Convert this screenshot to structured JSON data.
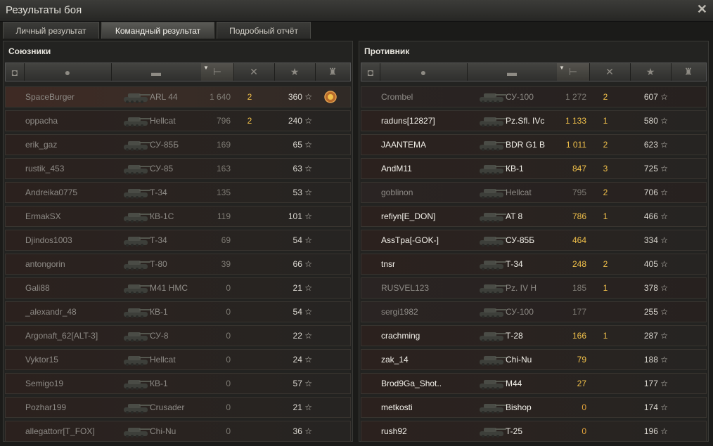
{
  "window": {
    "title": "Результаты боя",
    "close_icon": "close-icon"
  },
  "tabs": [
    {
      "label": "Личный результат",
      "active": false
    },
    {
      "label": "Командный результат",
      "active": true
    },
    {
      "label": "Подробный отчёт",
      "active": false
    }
  ],
  "allies": {
    "title": "Союзники",
    "rows": [
      {
        "name": "SpaceBurger",
        "tank": "ARL 44",
        "damage": "1 640",
        "kills": "2",
        "xp": "360",
        "medal": true,
        "highlight": true
      },
      {
        "name": "oppacha",
        "tank": "Hellcat",
        "damage": "796",
        "kills": "2",
        "xp": "240"
      },
      {
        "name": "erik_gaz",
        "tank": "СУ-85Б",
        "damage": "169",
        "kills": "",
        "xp": "65"
      },
      {
        "name": "rustik_453",
        "tank": "СУ-85",
        "damage": "163",
        "kills": "",
        "xp": "63"
      },
      {
        "name": "Andreika0775",
        "tank": "Т-34",
        "damage": "135",
        "kills": "",
        "xp": "53"
      },
      {
        "name": "ErmakSX",
        "tank": "КВ-1С",
        "damage": "119",
        "kills": "",
        "xp": "101"
      },
      {
        "name": "Djindos1003",
        "tank": "Т-34",
        "damage": "69",
        "kills": "",
        "xp": "54"
      },
      {
        "name": "antongorin",
        "tank": "Т-80",
        "damage": "39",
        "kills": "",
        "xp": "66"
      },
      {
        "name": "Gali88",
        "tank": "M41 HMC",
        "damage": "0",
        "kills": "",
        "xp": "21"
      },
      {
        "name": "_alexandr_48",
        "tank": "КВ-1",
        "damage": "0",
        "kills": "",
        "xp": "54"
      },
      {
        "name": "Argonaft_62[ALT-3]",
        "tank": "СУ-8",
        "damage": "0",
        "kills": "",
        "xp": "22"
      },
      {
        "name": "Vyktor15",
        "tank": "Hellcat",
        "damage": "0",
        "kills": "",
        "xp": "24"
      },
      {
        "name": "Semigo19",
        "tank": "КВ-1",
        "damage": "0",
        "kills": "",
        "xp": "57"
      },
      {
        "name": "Pozhar199",
        "tank": "Crusader",
        "damage": "0",
        "kills": "",
        "xp": "21"
      },
      {
        "name": "allegattorr[T_FOX]",
        "tank": "Chi-Nu",
        "damage": "0",
        "kills": "",
        "xp": "36"
      }
    ]
  },
  "enemies": {
    "title": "Противник",
    "rows": [
      {
        "name": "Crombel",
        "tank": "СУ-100",
        "damage": "1 272",
        "kills": "2",
        "xp": "607",
        "alive": false
      },
      {
        "name": "raduns[12827]",
        "tank": "Pz.Sfl. IVc",
        "damage": "1 133",
        "kills": "1",
        "xp": "580",
        "alive": true
      },
      {
        "name": "JAANTEMA",
        "tank": "BDR G1 B",
        "damage": "1 011",
        "kills": "2",
        "xp": "623",
        "alive": true
      },
      {
        "name": "AndM11",
        "tank": "КВ-1",
        "damage": "847",
        "kills": "3",
        "xp": "725",
        "alive": true
      },
      {
        "name": "goblinon",
        "tank": "Hellcat",
        "damage": "795",
        "kills": "2",
        "xp": "706",
        "alive": false
      },
      {
        "name": "refiyn[E_DON]",
        "tank": "AT 8",
        "damage": "786",
        "kills": "1",
        "xp": "466",
        "alive": true
      },
      {
        "name": "AssTpa[-GOK-]",
        "tank": "СУ-85Б",
        "damage": "464",
        "kills": "",
        "xp": "334",
        "alive": true
      },
      {
        "name": "tnsr",
        "tank": "Т-34",
        "damage": "248",
        "kills": "2",
        "xp": "405",
        "alive": true
      },
      {
        "name": "RUSVEL123",
        "tank": "Pz. IV H",
        "damage": "185",
        "kills": "1",
        "xp": "378",
        "alive": false
      },
      {
        "name": "sergi1982",
        "tank": "СУ-100",
        "damage": "177",
        "kills": "",
        "xp": "255",
        "alive": false
      },
      {
        "name": "crachming",
        "tank": "Т-28",
        "damage": "166",
        "kills": "1",
        "xp": "287",
        "alive": true
      },
      {
        "name": "zak_14",
        "tank": "Chi-Nu",
        "damage": "79",
        "kills": "",
        "xp": "188",
        "alive": true
      },
      {
        "name": "Brod9Ga_Shot..",
        "tank": "M44",
        "damage": "27",
        "kills": "",
        "xp": "177",
        "alive": true
      },
      {
        "name": "metkosti",
        "tank": "Bishop",
        "damage": "0",
        "kills": "",
        "xp": "174",
        "alive": true
      },
      {
        "name": "rush92",
        "tank": "T-25",
        "damage": "0",
        "kills": "",
        "xp": "196",
        "alive": true
      }
    ]
  },
  "columns": [
    "squad-icon",
    "player-icon",
    "tank-icon",
    "damage-icon",
    "kills-icon",
    "xp-star-icon",
    "medal-icon"
  ],
  "star_glyph": "☆",
  "colors": {
    "accent_yellow": "#f0c04a",
    "text_bright": "#f3f1ea",
    "text_dim": "#8e8b86"
  }
}
